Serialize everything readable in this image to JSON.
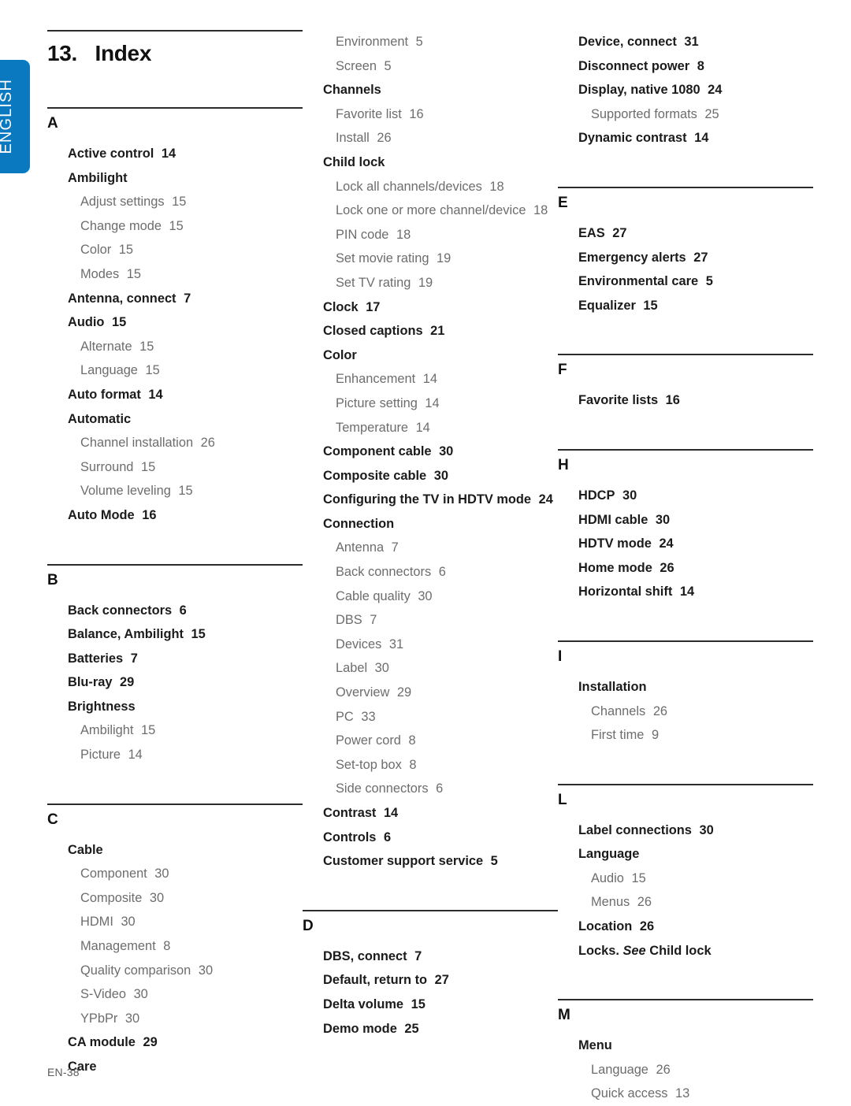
{
  "language_tab": {
    "label": "ENGLISH",
    "color": "#0b79c0"
  },
  "header": {
    "chapter_number": "13.",
    "title": "Index",
    "full_title": "13.   Index"
  },
  "footer": {
    "page_label": "EN-38"
  },
  "columns": [
    {
      "id": "column-1",
      "sections": [
        {
          "letter": "A",
          "entries": [
            {
              "type": "main",
              "text": "Active control",
              "page": "14"
            },
            {
              "type": "main",
              "text": "Ambilight",
              "page": ""
            },
            {
              "type": "sub",
              "text": "Adjust settings",
              "page": "15"
            },
            {
              "type": "sub",
              "text": "Change mode",
              "page": "15"
            },
            {
              "type": "sub",
              "text": "Color",
              "page": "15"
            },
            {
              "type": "sub",
              "text": "Modes",
              "page": "15"
            },
            {
              "type": "main",
              "text": "Antenna, connect",
              "page": "7"
            },
            {
              "type": "main",
              "text": "Audio",
              "page": "15"
            },
            {
              "type": "sub",
              "text": "Alternate",
              "page": "15"
            },
            {
              "type": "sub",
              "text": "Language",
              "page": "15"
            },
            {
              "type": "main",
              "text": "Auto format",
              "page": "14"
            },
            {
              "type": "main",
              "text": "Automatic",
              "page": ""
            },
            {
              "type": "sub",
              "text": "Channel installation",
              "page": "26"
            },
            {
              "type": "sub",
              "text": "Surround",
              "page": "15"
            },
            {
              "type": "sub",
              "text": "Volume leveling",
              "page": "15"
            },
            {
              "type": "main",
              "text": "Auto Mode",
              "page": "16"
            }
          ]
        },
        {
          "letter": "B",
          "entries": [
            {
              "type": "main",
              "text": "Back connectors",
              "page": "6"
            },
            {
              "type": "main",
              "text": "Balance, Ambilight",
              "page": "15"
            },
            {
              "type": "main",
              "text": "Batteries",
              "page": "7"
            },
            {
              "type": "main",
              "text": "Blu-ray",
              "page": "29"
            },
            {
              "type": "main",
              "text": "Brightness",
              "page": ""
            },
            {
              "type": "sub",
              "text": "Ambilight",
              "page": "15"
            },
            {
              "type": "sub",
              "text": "Picture",
              "page": "14"
            }
          ]
        },
        {
          "letter": "C",
          "entries": [
            {
              "type": "main",
              "text": "Cable",
              "page": ""
            },
            {
              "type": "sub",
              "text": "Component",
              "page": "30"
            },
            {
              "type": "sub",
              "text": "Composite",
              "page": "30"
            },
            {
              "type": "sub",
              "text": "HDMI",
              "page": "30"
            },
            {
              "type": "sub",
              "text": "Management",
              "page": "8"
            },
            {
              "type": "sub",
              "text": "Quality comparison",
              "page": "30"
            },
            {
              "type": "sub",
              "text": "S-Video",
              "page": "30"
            },
            {
              "type": "sub",
              "text": "YPbPr",
              "page": "30"
            },
            {
              "type": "main",
              "text": "CA module",
              "page": "29"
            },
            {
              "type": "main",
              "text": "Care",
              "page": ""
            }
          ]
        }
      ]
    },
    {
      "id": "column-2",
      "sections": [
        {
          "letter": "",
          "entries": [
            {
              "type": "sub",
              "text": "Environment",
              "page": "5"
            },
            {
              "type": "sub",
              "text": "Screen",
              "page": "5"
            },
            {
              "type": "main",
              "text": "Channels",
              "page": ""
            },
            {
              "type": "sub",
              "text": "Favorite list",
              "page": "16"
            },
            {
              "type": "sub",
              "text": "Install",
              "page": "26"
            },
            {
              "type": "main",
              "text": "Child lock",
              "page": ""
            },
            {
              "type": "sub",
              "text": "Lock all channels/devices",
              "page": "18"
            },
            {
              "type": "sub",
              "text": "Lock one or more channel/device",
              "page": "18"
            },
            {
              "type": "sub",
              "text": "PIN code",
              "page": "18"
            },
            {
              "type": "sub",
              "text": "Set movie rating",
              "page": "19"
            },
            {
              "type": "sub",
              "text": "Set TV rating",
              "page": "19"
            },
            {
              "type": "main",
              "text": "Clock",
              "page": "17"
            },
            {
              "type": "main",
              "text": "Closed captions",
              "page": "21"
            },
            {
              "type": "main",
              "text": "Color",
              "page": ""
            },
            {
              "type": "sub",
              "text": "Enhancement",
              "page": "14"
            },
            {
              "type": "sub",
              "text": "Picture setting",
              "page": "14"
            },
            {
              "type": "sub",
              "text": "Temperature",
              "page": "14"
            },
            {
              "type": "main",
              "text": "Component cable",
              "page": "30"
            },
            {
              "type": "main",
              "text": "Composite cable",
              "page": "30"
            },
            {
              "type": "main",
              "text": "Configuring the TV in HDTV mode",
              "page": "24"
            },
            {
              "type": "main",
              "text": "Connection",
              "page": ""
            },
            {
              "type": "sub",
              "text": "Antenna",
              "page": "7"
            },
            {
              "type": "sub",
              "text": "Back connectors",
              "page": "6"
            },
            {
              "type": "sub",
              "text": "Cable quality",
              "page": "30"
            },
            {
              "type": "sub",
              "text": "DBS",
              "page": "7"
            },
            {
              "type": "sub",
              "text": "Devices",
              "page": "31"
            },
            {
              "type": "sub",
              "text": "Label",
              "page": "30"
            },
            {
              "type": "sub",
              "text": "Overview",
              "page": "29"
            },
            {
              "type": "sub",
              "text": "PC",
              "page": "33"
            },
            {
              "type": "sub",
              "text": "Power cord",
              "page": "8"
            },
            {
              "type": "sub",
              "text": "Set-top box",
              "page": "8"
            },
            {
              "type": "sub",
              "text": "Side connectors",
              "page": "6"
            },
            {
              "type": "main",
              "text": "Contrast",
              "page": "14"
            },
            {
              "type": "main",
              "text": "Controls",
              "page": "6"
            },
            {
              "type": "main",
              "text": "Customer support service",
              "page": "5"
            }
          ]
        },
        {
          "letter": "D",
          "entries": [
            {
              "type": "main",
              "text": "DBS, connect",
              "page": "7"
            },
            {
              "type": "main",
              "text": "Default, return to",
              "page": "27"
            },
            {
              "type": "main",
              "text": "Delta volume",
              "page": "15"
            },
            {
              "type": "main",
              "text": "Demo mode",
              "page": "25"
            }
          ]
        }
      ]
    },
    {
      "id": "column-3",
      "sections": [
        {
          "letter": "",
          "entries": [
            {
              "type": "main",
              "text": "Device, connect",
              "page": "31"
            },
            {
              "type": "main",
              "text": "Disconnect power",
              "page": "8"
            },
            {
              "type": "main",
              "text": "Display, native 1080",
              "page": "24"
            },
            {
              "type": "sub",
              "text": "Supported formats",
              "page": "25"
            },
            {
              "type": "main",
              "text": "Dynamic contrast",
              "page": "14"
            }
          ]
        },
        {
          "letter": "E",
          "entries": [
            {
              "type": "main",
              "text": "EAS",
              "page": "27"
            },
            {
              "type": "main",
              "text": "Emergency alerts",
              "page": "27"
            },
            {
              "type": "main",
              "text": "Environmental care",
              "page": "5"
            },
            {
              "type": "main",
              "text": "Equalizer",
              "page": "15"
            }
          ]
        },
        {
          "letter": "F",
          "entries": [
            {
              "type": "main",
              "text": "Favorite lists",
              "page": "16"
            }
          ]
        },
        {
          "letter": "H",
          "entries": [
            {
              "type": "main",
              "text": "HDCP",
              "page": "30"
            },
            {
              "type": "main",
              "text": "HDMI cable",
              "page": "30"
            },
            {
              "type": "main",
              "text": "HDTV mode",
              "page": "24"
            },
            {
              "type": "main",
              "text": "Home mode",
              "page": "26"
            },
            {
              "type": "main",
              "text": "Horizontal shift",
              "page": "14"
            }
          ]
        },
        {
          "letter": "I",
          "entries": [
            {
              "type": "main",
              "text": "Installation",
              "page": ""
            },
            {
              "type": "sub",
              "text": "Channels",
              "page": "26"
            },
            {
              "type": "sub",
              "text": "First time",
              "page": "9"
            }
          ]
        },
        {
          "letter": "L",
          "entries": [
            {
              "type": "main",
              "text": "Label connections",
              "page": "30"
            },
            {
              "type": "main",
              "text": "Language",
              "page": ""
            },
            {
              "type": "sub",
              "text": "Audio",
              "page": "15"
            },
            {
              "type": "sub",
              "text": "Menus",
              "page": "26"
            },
            {
              "type": "main",
              "text": "Location",
              "page": "26"
            },
            {
              "type": "main",
              "text": "Locks.",
              "page": "",
              "italic_part": "See",
              "tail": "Child lock"
            }
          ]
        },
        {
          "letter": "M",
          "entries": [
            {
              "type": "main",
              "text": "Menu",
              "page": ""
            },
            {
              "type": "sub",
              "text": "Language",
              "page": "26"
            },
            {
              "type": "sub",
              "text": "Quick access",
              "page": "13"
            }
          ]
        }
      ]
    }
  ]
}
